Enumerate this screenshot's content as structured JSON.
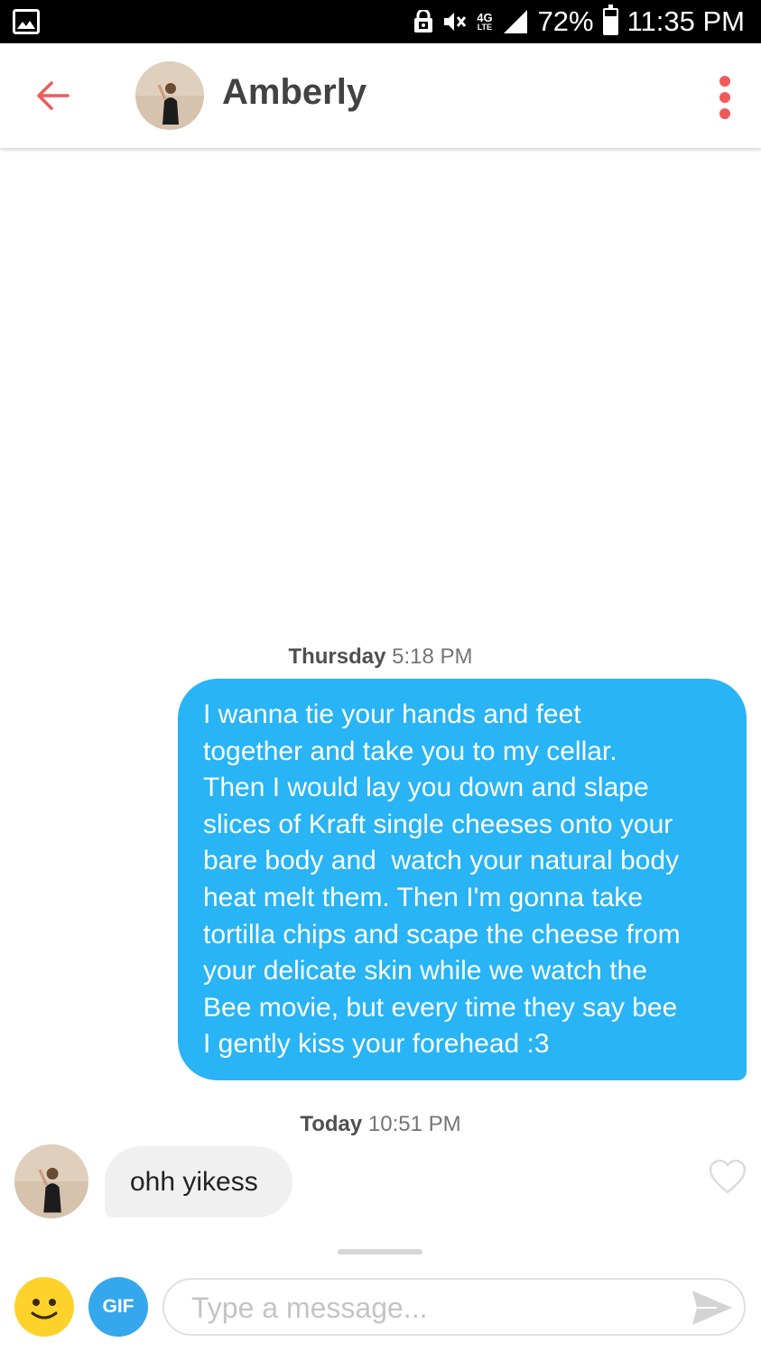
{
  "status_bar": {
    "battery": "72%",
    "time": "11:35 PM",
    "network": "4G",
    "network_sub": "LTE",
    "icons": [
      "image-icon",
      "lock-icon",
      "mute-icon",
      "lte-icon",
      "signal-icon",
      "battery-icon"
    ]
  },
  "header": {
    "name": "Amberly",
    "icons": [
      "back-arrow-icon",
      "overflow-menu-icon"
    ]
  },
  "conversation": {
    "timestamp_1": {
      "day": "Thursday",
      "time": "5:18 PM"
    },
    "sent_message": {
      "lines": [
        "I wanna tie your hands and feet",
        "together and take you to my cellar.",
        "Then I would lay you down and slape",
        "slices of Kraft single cheeses onto your",
        "bare body and  watch your natural body",
        "heat melt them. Then I'm gonna take",
        "tortilla chips and scape the cheese from",
        "your delicate skin while we watch the",
        "Bee movie, but every time they say bee",
        "I gently kiss your forehead :3"
      ]
    },
    "timestamp_2": {
      "day": "Today",
      "time": "10:51 PM"
    },
    "received_message": "ohh yikess"
  },
  "composer": {
    "gif_label": "GIF",
    "placeholder": "Type a message...",
    "icons": [
      "emoji-icon",
      "gif-icon",
      "send-icon",
      "heart-icon"
    ]
  },
  "colors": {
    "accent": "#ef5a5a",
    "sent_bubble": "#28b4f5",
    "received_bubble": "#f0f0f0",
    "gif_button": "#35a7ed",
    "emoji_button": "#fdd22a"
  }
}
